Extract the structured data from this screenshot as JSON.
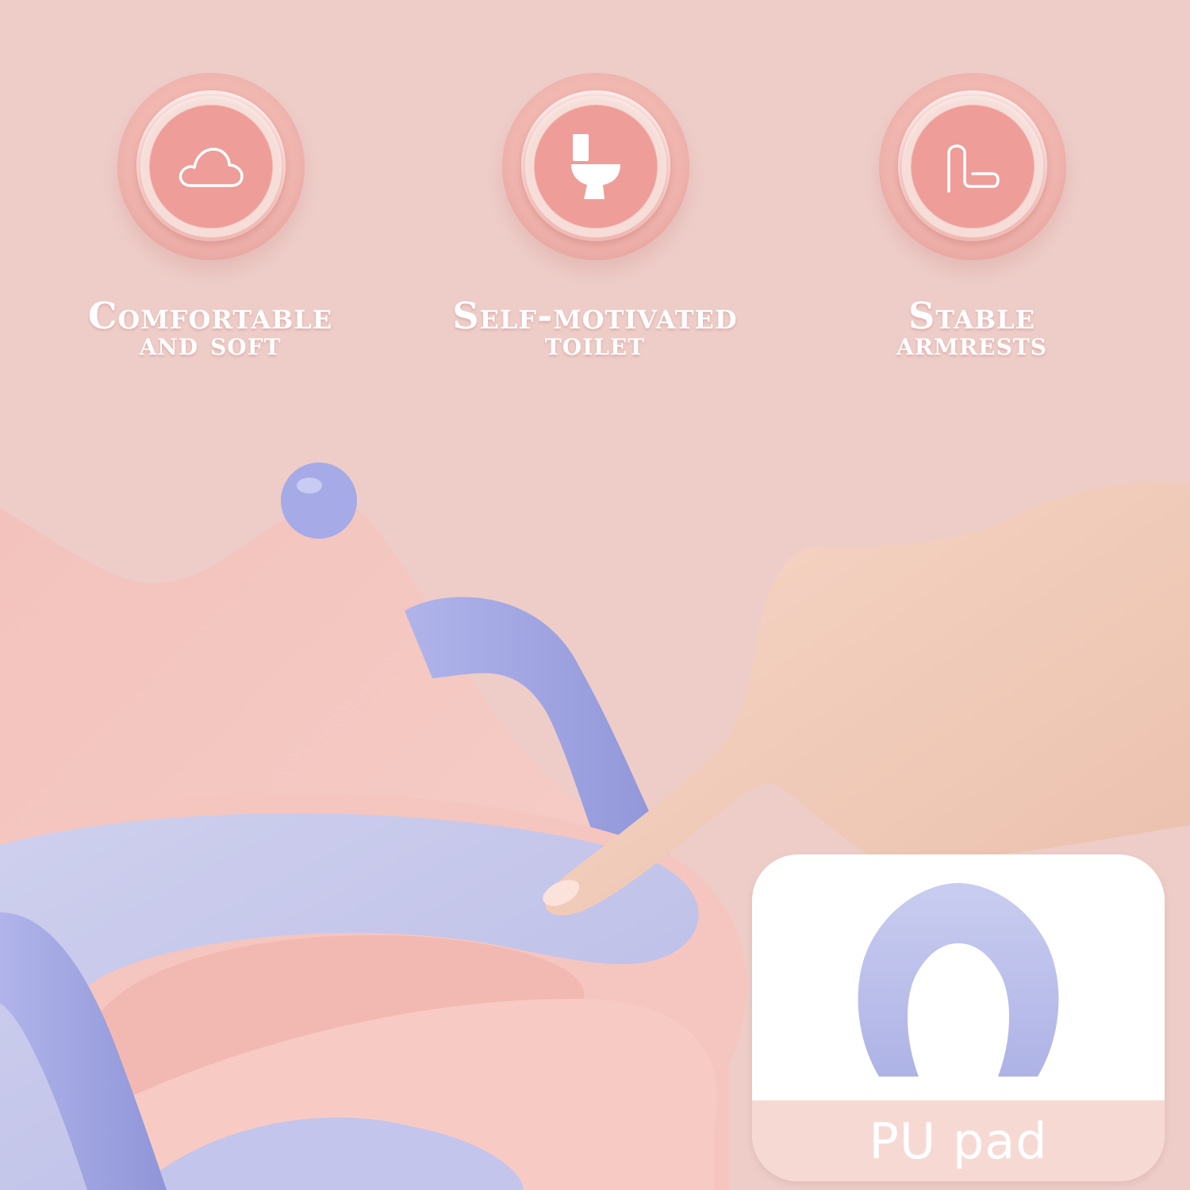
{
  "features": [
    {
      "icon": "cloud-icon",
      "line1": "Comfortable",
      "line2": "and soft"
    },
    {
      "icon": "toilet-icon",
      "line1": "Self-motivated",
      "line2": "toilet"
    },
    {
      "icon": "armrest-icon",
      "line1": "Stable",
      "line2": "armrests"
    }
  ],
  "pad_card": {
    "label": "PU pad"
  },
  "colors": {
    "background": "#eecdc8",
    "badge": "#ee9d98",
    "seat_pink": "#f4c0ba",
    "seat_lavender": "#b9b9e6",
    "handle": "#a3a8e3"
  }
}
